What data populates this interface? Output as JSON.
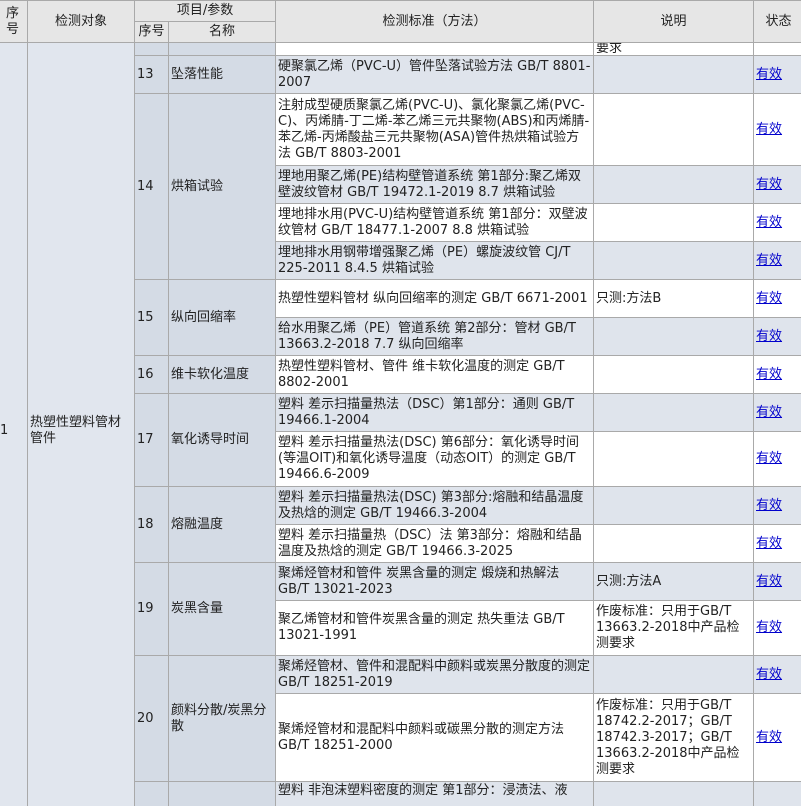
{
  "headers": {
    "seq": "序号",
    "object": "检测对象",
    "item_params": "项目/参数",
    "standard": "检测标准（方法）",
    "note": "说明",
    "status": "状态",
    "sub_seq": "序号",
    "sub_name": "名称"
  },
  "group": {
    "seq": "1",
    "object": "热塑性塑料管材管件"
  },
  "top_partial_note": "要求",
  "rows": [
    {
      "seq": "13",
      "name": "坠落性能",
      "standard": "硬聚氯乙烯（PVC-U）管件坠落试验方法 GB/T 8801-2007",
      "note": "",
      "status": "有效"
    },
    {
      "seq": "14",
      "name": "烘箱试验",
      "standard": "注射成型硬质聚氯乙烯(PVC-U)、氯化聚氯乙烯(PVC-C)、丙烯腈-丁二烯-苯乙烯三元共聚物(ABS)和丙烯腈-苯乙烯-丙烯酸盐三元共聚物(ASA)管件热烘箱试验方法 GB/T 8803-2001",
      "note": "",
      "status": "有效"
    },
    {
      "standard": "埋地用聚乙烯(PE)结构壁管道系统 第1部分:聚乙烯双壁波纹管材 GB/T 19472.1-2019 8.7 烘箱试验",
      "note": "",
      "status": "有效"
    },
    {
      "standard": "埋地排水用(PVC-U)结构壁管道系统 第1部分：双壁波纹管材 GB/T 18477.1-2007 8.8 烘箱试验",
      "note": "",
      "status": "有效"
    },
    {
      "standard": "埋地排水用钢带增强聚乙烯（PE）螺旋波纹管 CJ/T 225-2011 8.4.5 烘箱试验",
      "note": "",
      "status": "有效"
    },
    {
      "seq": "15",
      "name": "纵向回缩率",
      "standard": "热塑性塑料管材 纵向回缩率的测定 GB/T 6671-2001",
      "note": "只测:方法B",
      "status": "有效"
    },
    {
      "standard": "给水用聚乙烯（PE）管道系统 第2部分：管材 GB/T 13663.2-2018 7.7 纵向回缩率",
      "note": "",
      "status": "有效"
    },
    {
      "seq": "16",
      "name": "维卡软化温度",
      "standard": "热塑性塑料管材、管件 维卡软化温度的测定 GB/T 8802-2001",
      "note": "",
      "status": "有效"
    },
    {
      "seq": "17",
      "name": "氧化诱导时间",
      "standard": "塑料 差示扫描量热法（DSC）第1部分：通则 GB/T 19466.1-2004",
      "note": "",
      "status": "有效"
    },
    {
      "standard": "塑料 差示扫描量热法(DSC) 第6部分：氧化诱导时间(等温OIT)和氧化诱导温度（动态OIT）的测定 GB/T 19466.6-2009",
      "note": "",
      "status": "有效"
    },
    {
      "seq": "18",
      "name": "熔融温度",
      "standard": "塑料 差示扫描量热法(DSC) 第3部分:熔融和结晶温度及热焓的测定 GB/T 19466.3-2004",
      "note": "",
      "status": "有效"
    },
    {
      "standard": "塑料 差示扫描量热（DSC）法 第3部分：熔融和结晶温度及热焓的测定 GB/T 19466.3-2025",
      "note": "",
      "status": "有效"
    },
    {
      "seq": "19",
      "name": "炭黑含量",
      "standard": "聚烯烃管材和管件 炭黑含量的测定 煅烧和热解法 GB/T 13021-2023",
      "note": "只测:方法A",
      "status": "有效"
    },
    {
      "standard": "聚乙烯管材和管件炭黑含量的测定 热失重法 GB/T 13021-1991",
      "note": "作废标准：只用于GB/T 13663.2-2018中产品检测要求",
      "status": "有效"
    },
    {
      "seq": "20",
      "name": "颜料分散/炭黑分散",
      "standard": "聚烯烃管材、管件和混配料中颜料或炭黑分散度的测定 GB/T 18251-2019",
      "note": "",
      "status": "有效"
    },
    {
      "standard": "聚烯烃管材和混配料中颜料或碳黑分散的测定方法 GB/T 18251-2000",
      "note": "作废标准：只用于GB/T 18742.2-2017；GB/T 18742.3-2017；GB/T 13663.2-2018中产品检测要求",
      "status": "有效"
    }
  ],
  "bottom_partial_standard": "塑料 非泡沫塑料密度的测定 第1部分：浸渍法、液"
}
